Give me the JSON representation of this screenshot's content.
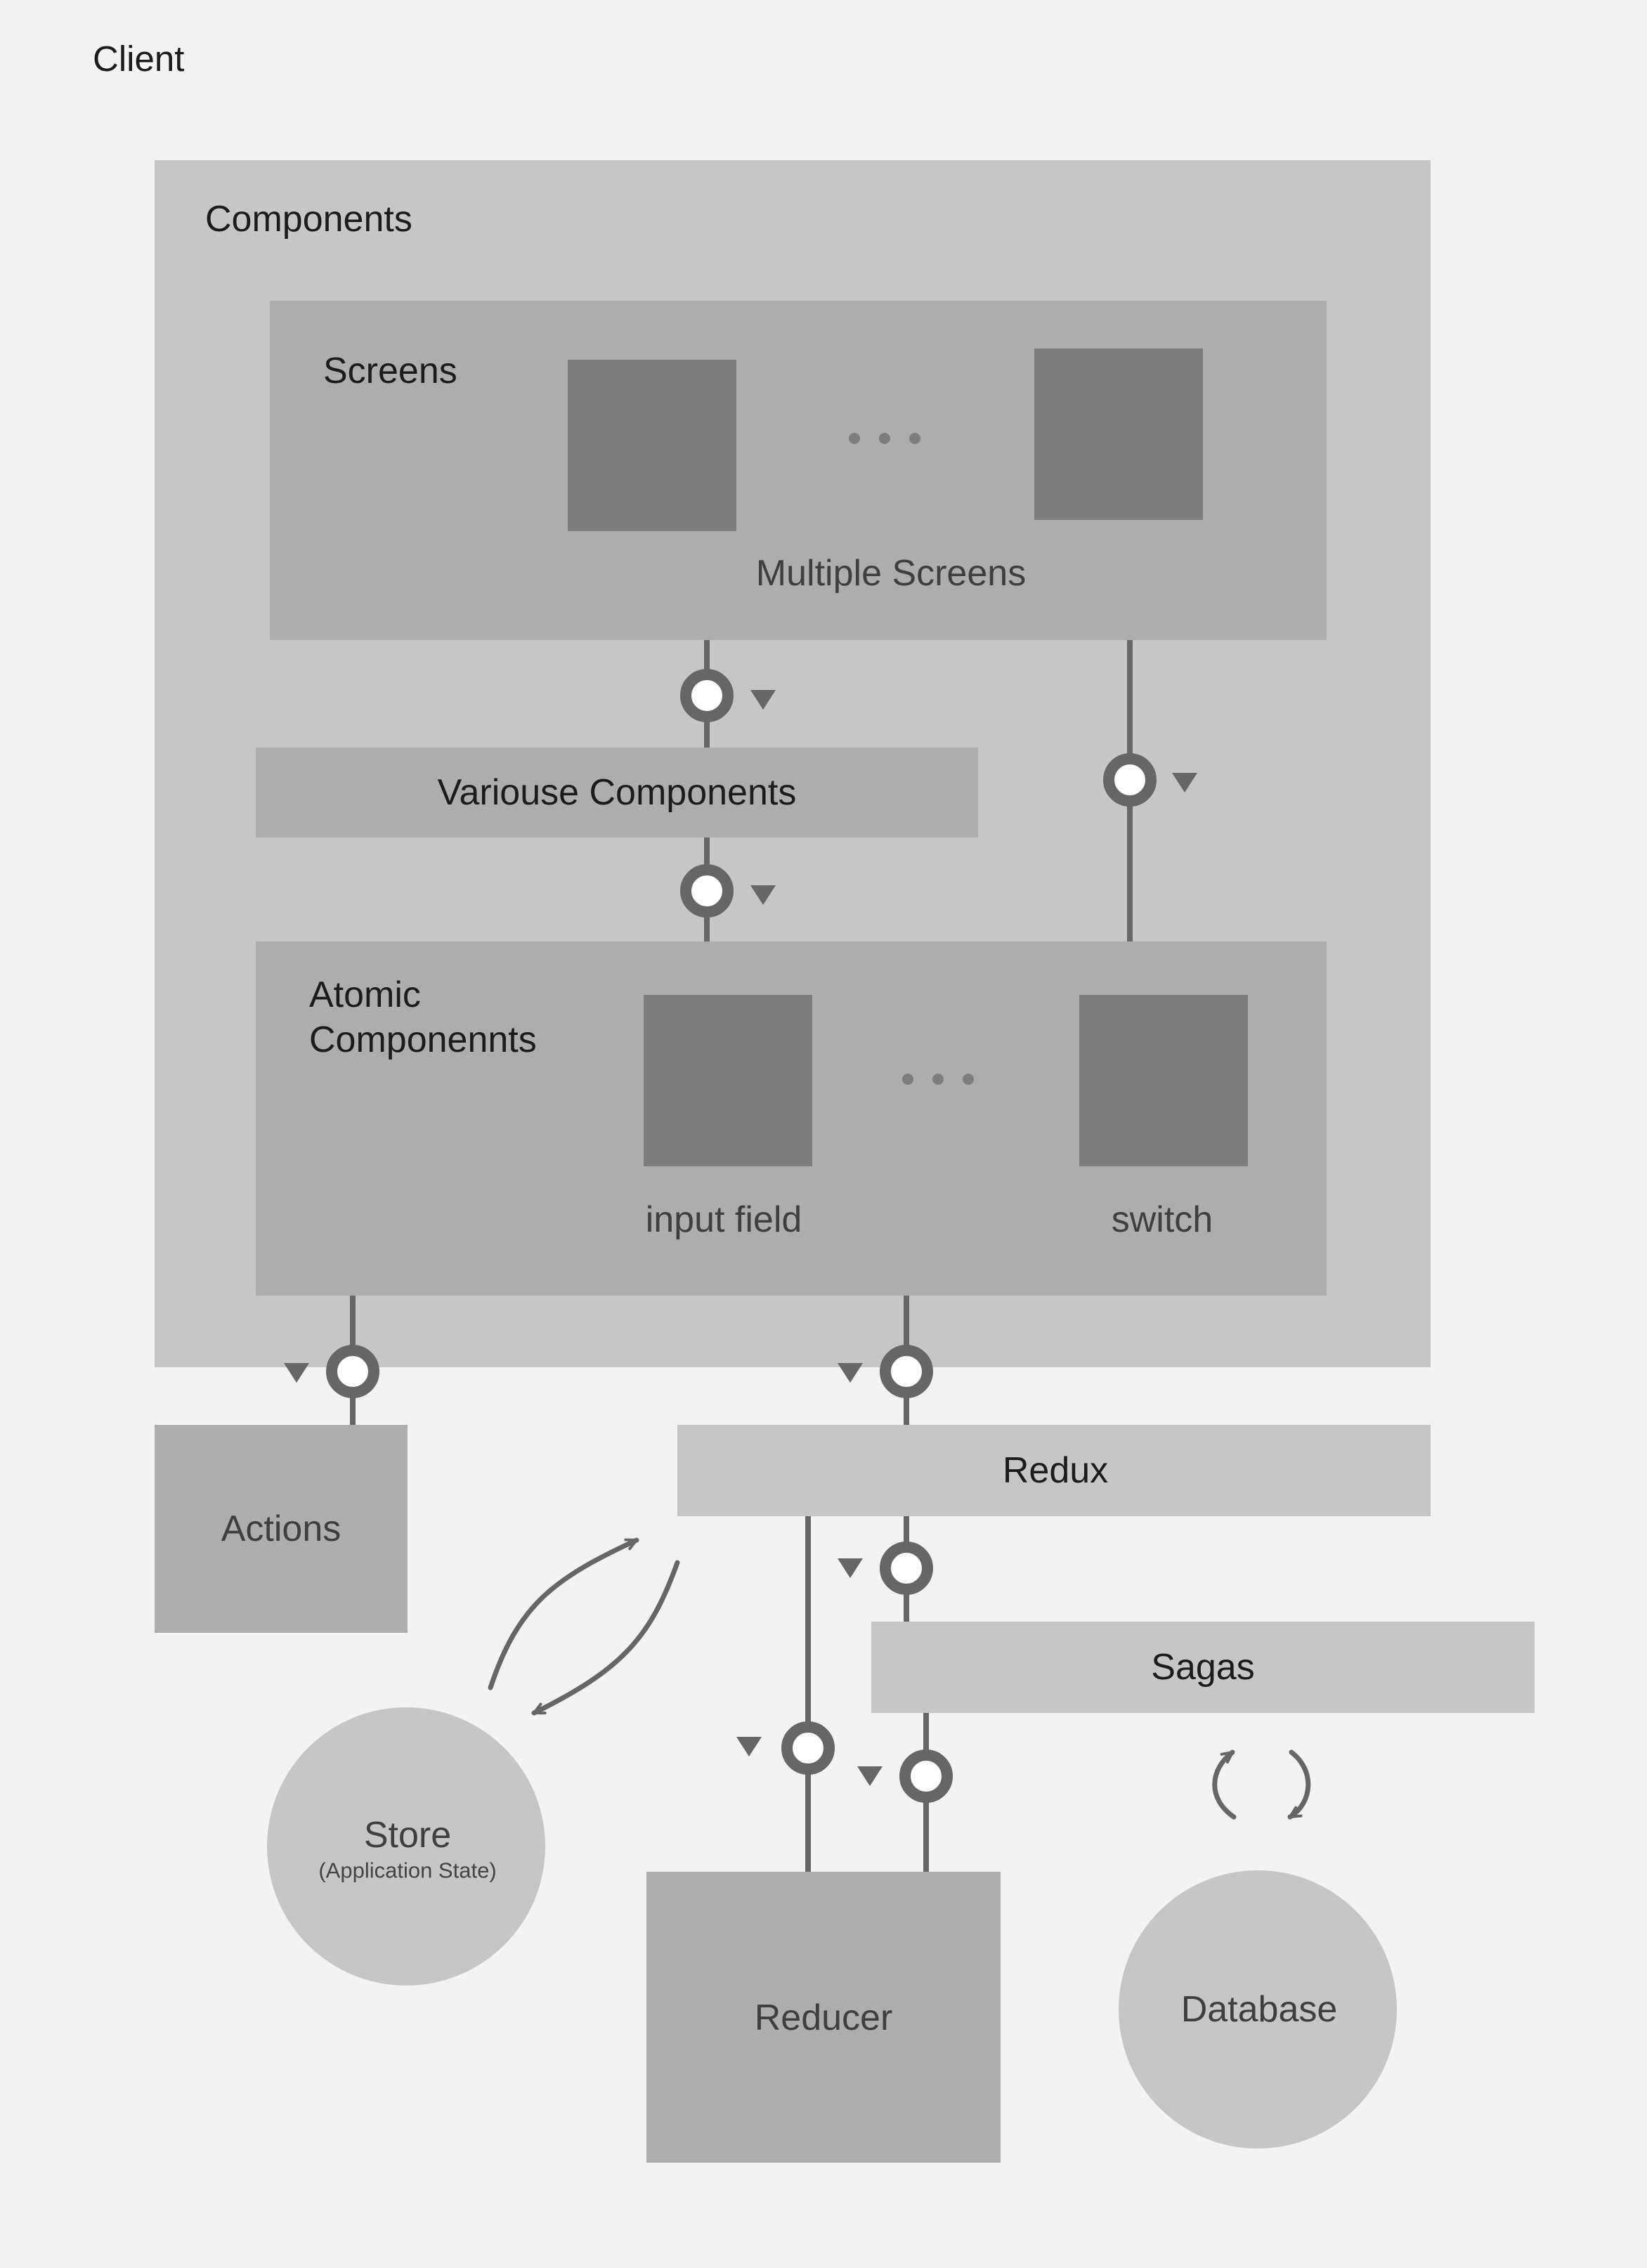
{
  "page": {
    "title": "Client"
  },
  "components": {
    "label": "Components"
  },
  "screens": {
    "label": "Screens",
    "caption": "Multiple Screens"
  },
  "various": {
    "label": "Variouse Components"
  },
  "atomic": {
    "label_line1": "Atomic",
    "label_line2": "Componennts",
    "item1": "input field",
    "item2": "switch"
  },
  "actions": {
    "label": "Actions"
  },
  "redux": {
    "label": "Redux"
  },
  "sagas": {
    "label": "Sagas"
  },
  "store": {
    "label": "Store",
    "sublabel": "(Application State)"
  },
  "reducer": {
    "label": "Reducer"
  },
  "database": {
    "label": "Database"
  },
  "colors": {
    "background": "#f3f3f3",
    "container": "#c6c6c6",
    "block": "#adadad",
    "tile": "#7d7d7d",
    "connector": "#666666"
  }
}
